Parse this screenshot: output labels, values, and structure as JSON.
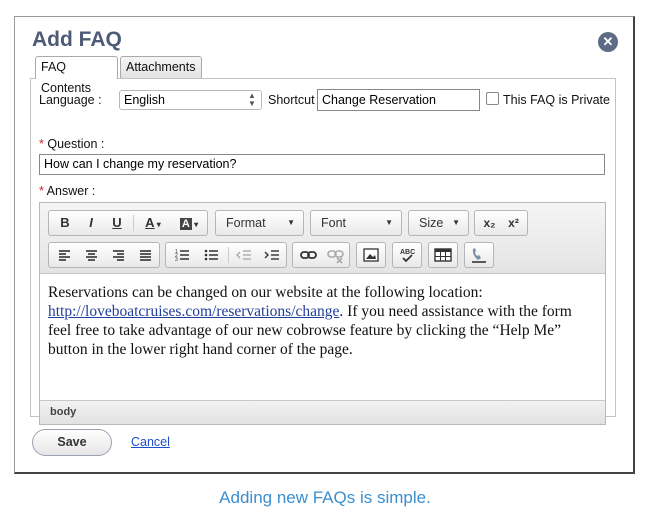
{
  "dialog": {
    "title": "Add FAQ",
    "close_icon": "close-icon"
  },
  "tabs": [
    {
      "label": "FAQ Contents",
      "active": true
    },
    {
      "label": "Attachments",
      "active": false
    }
  ],
  "form": {
    "language_label": "Language :",
    "language_value": "English",
    "shortcut_label": "Shortcut :",
    "shortcut_value": "Change Reservation",
    "private_label": "This FAQ is Private",
    "private_checked": false,
    "required_marker": "*",
    "question_label": "Question :",
    "question_value": "How can I change my reservation?",
    "answer_label": "Answer :"
  },
  "toolbar": {
    "bold": "B",
    "italic": "I",
    "underline": "U",
    "text_color": "A",
    "bg_color": "A",
    "format_label": "Format",
    "font_label": "Font",
    "size_label": "Size",
    "subscript": "x₂",
    "superscript": "x²",
    "spellcheck": "ABC",
    "icons": [
      "align-left-icon",
      "align-center-icon",
      "align-right-icon",
      "justify-icon",
      "numbered-list-icon",
      "bullet-list-icon",
      "outdent-icon",
      "indent-icon",
      "link-icon",
      "unlink-icon",
      "image-icon",
      "spellcheck-icon",
      "table-icon",
      "phone-icon"
    ]
  },
  "answer": {
    "text_before": "Reservations can be changed on our website at the following location: ",
    "link": "http://loveboatcruises.com/reservations/change",
    "text_after": ".  If you need assistance with the form feel free to take advantage of our new cobrowse feature by clicking the “Help Me” button in the lower right hand corner of the page."
  },
  "statusbar": "body",
  "actions": {
    "save_label": "Save",
    "cancel_label": "Cancel"
  },
  "caption": "Adding new FAQs is simple.",
  "colors": {
    "title": "#4e5b77",
    "link": "#1f3f98",
    "caption": "#3a8fd0",
    "required": "#d0202a"
  }
}
